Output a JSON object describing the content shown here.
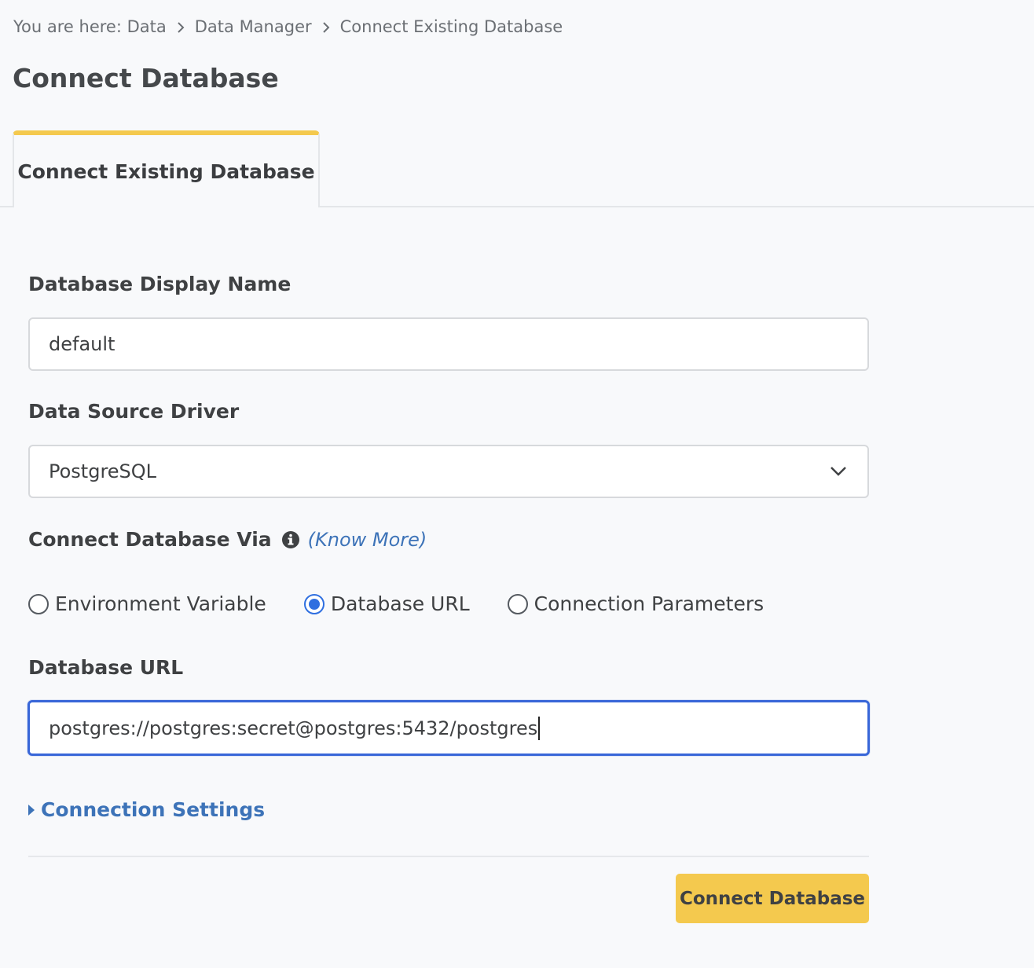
{
  "breadcrumb": {
    "prefix": "You are here: ",
    "items": [
      "Data",
      "Data Manager",
      "Connect Existing Database"
    ]
  },
  "page_title": "Connect Database",
  "tabs": [
    {
      "label": "Connect Existing Database",
      "active": true
    }
  ],
  "form": {
    "display_name": {
      "label": "Database Display Name",
      "value": "default"
    },
    "driver": {
      "label": "Data Source Driver",
      "value": "PostgreSQL"
    },
    "connect_via": {
      "label": "Connect Database Via",
      "know_more": "(Know More)",
      "options": [
        "Environment Variable",
        "Database URL",
        "Connection Parameters"
      ],
      "selected": "Database URL"
    },
    "database_url": {
      "label": "Database URL",
      "value": "postgres://postgres:secret@postgres:5432/postgres"
    },
    "connection_settings": "Connection Settings",
    "submit_label": "Connect Database"
  },
  "colors": {
    "accent_yellow": "#f4c94e",
    "link_blue": "#3d73b8",
    "focus_blue": "#3866d8",
    "radio_blue": "#2f6fe0"
  },
  "icons": {
    "breadcrumb_separator": "chevron-right-icon",
    "select": "chevron-down-icon",
    "info": "info-icon",
    "expand": "caret-right-icon"
  }
}
